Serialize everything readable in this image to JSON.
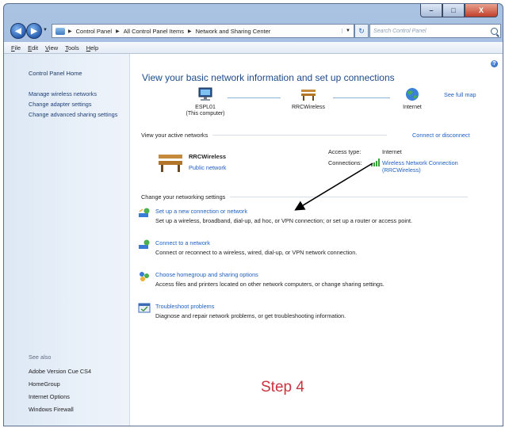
{
  "window": {
    "controls": {
      "minimize": "–",
      "maximize": "□",
      "close": "X"
    }
  },
  "navbar": {
    "back": "◀",
    "forward": "▶",
    "breadcrumbs": [
      "Control Panel",
      "All Control Panel Items",
      "Network and Sharing Center"
    ],
    "search_placeholder": "Search Control Panel"
  },
  "menu": {
    "items": [
      {
        "key": "F",
        "rest": "ile"
      },
      {
        "key": "E",
        "rest": "dit"
      },
      {
        "key": "V",
        "rest": "iew"
      },
      {
        "key": "T",
        "rest": "ools"
      },
      {
        "key": "H",
        "rest": "elp"
      }
    ]
  },
  "sidebar": {
    "home": "Control Panel Home",
    "links": [
      "Manage wireless networks",
      "Change adapter settings",
      "Change advanced sharing settings"
    ],
    "see_also_label": "See also",
    "see_also": [
      "Adobe Version Cue CS4",
      "HomeGroup",
      "Internet Options",
      "Windows Firewall"
    ]
  },
  "main": {
    "help": "?",
    "title": "View your basic network information and set up connections",
    "see_full_map": "See full map",
    "map": {
      "computer_name": "ESPL01",
      "computer_sub": "(This computer)",
      "network": "RRCWireless",
      "internet": "Internet"
    },
    "active_header": "View your active networks",
    "connect_or_disconnect": "Connect or disconnect",
    "active_network": {
      "name": "RRCWireless",
      "type": "Public network",
      "access_type_label": "Access type:",
      "access_type_value": "Internet",
      "connections_label": "Connections:",
      "connection_value_line1": "Wireless Network Connection",
      "connection_value_line2": "(RRCWireless)"
    },
    "change_header": "Change your networking settings",
    "tasks": [
      {
        "title": "Set up a new connection or network",
        "desc": "Set up a wireless, broadband, dial-up, ad hoc, or VPN connection; or set up a router or access point."
      },
      {
        "title": "Connect to a network",
        "desc": "Connect or reconnect to a wireless, wired, dial-up, or VPN network connection."
      },
      {
        "title": "Choose homegroup and sharing options",
        "desc": "Access files and printers located on other network computers, or change sharing settings."
      },
      {
        "title": "Troubleshoot problems",
        "desc": "Diagnose and repair network problems, or get troubleshooting information."
      }
    ],
    "step_label": "Step 4"
  },
  "colors": {
    "link": "#1f5fbf",
    "title": "#1e4a8a",
    "step": "#c8343d"
  }
}
